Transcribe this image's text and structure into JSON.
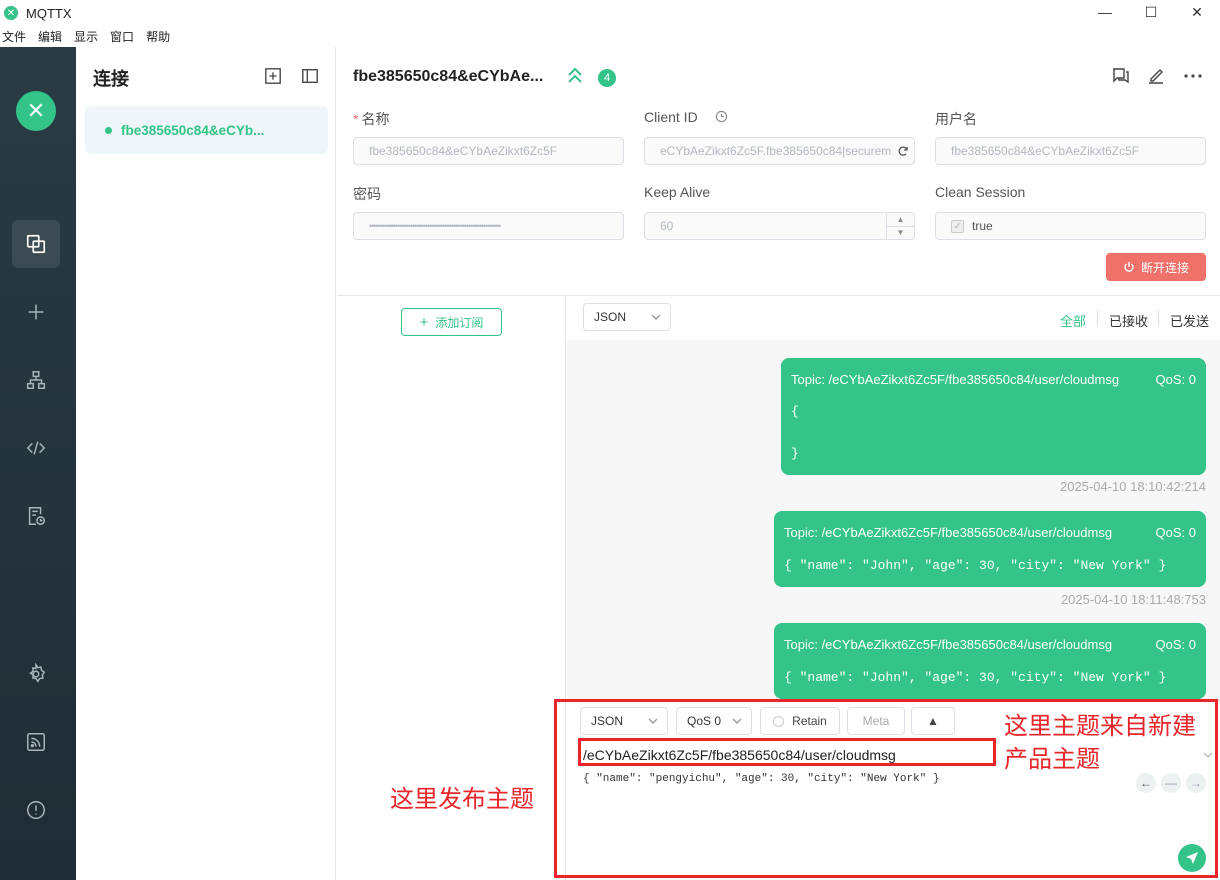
{
  "window": {
    "title": "MQTTX",
    "logo_glyph": "✕",
    "controls": [
      "—",
      "☐",
      "✕"
    ]
  },
  "menu": [
    "文件",
    "编辑",
    "显示",
    "窗口",
    "帮助"
  ],
  "connections": {
    "header": "连接",
    "items": [
      {
        "name": "fbe385650c84&eCYb...",
        "status": "connected"
      }
    ]
  },
  "conn_header": {
    "title": "fbe385650c84&eCYbAe...",
    "badge": "4"
  },
  "form": {
    "name_label": "名称",
    "name_value": "fbe385650c84&eCYbAeZikxt6Zc5F",
    "client_id_label": "Client ID",
    "client_id_value": "eCYbAeZikxt6Zc5F.fbe385650c84|securem",
    "username_label": "用户名",
    "username_value": "fbe385650c84&eCYbAeZikxt6Zc5F",
    "password_label": "密码",
    "password_value": "•••••••••••••••••••••••••••••••••••••••••••••••••••••••••••••",
    "keepalive_label": "Keep Alive",
    "keepalive_value": "60",
    "clean_session_label": "Clean Session",
    "clean_session_value": "true",
    "disconnect_label": "断开连接"
  },
  "subscriptions": {
    "add_label": "添加订阅"
  },
  "messages": {
    "format": "JSON",
    "filters": [
      "全部",
      "已接收",
      "已发送"
    ],
    "active_filter": "全部",
    "items": [
      {
        "topic": "Topic: /eCYbAeZikxt6Zc5F/fbe385650c84/user/cloudmsg",
        "qos": "QoS: 0",
        "body_lines": [
          "{",
          "",
          "}"
        ],
        "time": "2025-04-10 18:10:42:214"
      },
      {
        "topic": "Topic: /eCYbAeZikxt6Zc5F/fbe385650c84/user/cloudmsg",
        "qos": "QoS: 0",
        "body_lines": [
          "{ \"name\": \"John\", \"age\": 30, \"city\": \"New York\" }"
        ],
        "time": "2025-04-10 18:11:48:753"
      },
      {
        "topic": "Topic: /eCYbAeZikxt6Zc5F/fbe385650c84/user/cloudmsg",
        "qos": "QoS: 0",
        "body_lines": [
          "{ \"name\": \"John\", \"age\": 30, \"city\": \"New York\" }"
        ],
        "time": ""
      }
    ]
  },
  "publish": {
    "format": "JSON",
    "qos": "QoS 0",
    "retain_label": "Retain",
    "meta_label": "Meta",
    "topic": "/eCYbAeZikxt6Zc5F/fbe385650c84/user/cloudmsg",
    "payload": "{ \"name\": \"pengyichu\", \"age\": 30, \"city\": \"New York\" }"
  },
  "annotations": {
    "publish_topic": "这里发布主题",
    "topic_source_line1": "这里主题来自新建",
    "topic_source_line2": "产品主题",
    "color": "#e8252a"
  },
  "colors": {
    "accent": "#34c388",
    "danger": "#f0706a",
    "rail": "#253640"
  }
}
